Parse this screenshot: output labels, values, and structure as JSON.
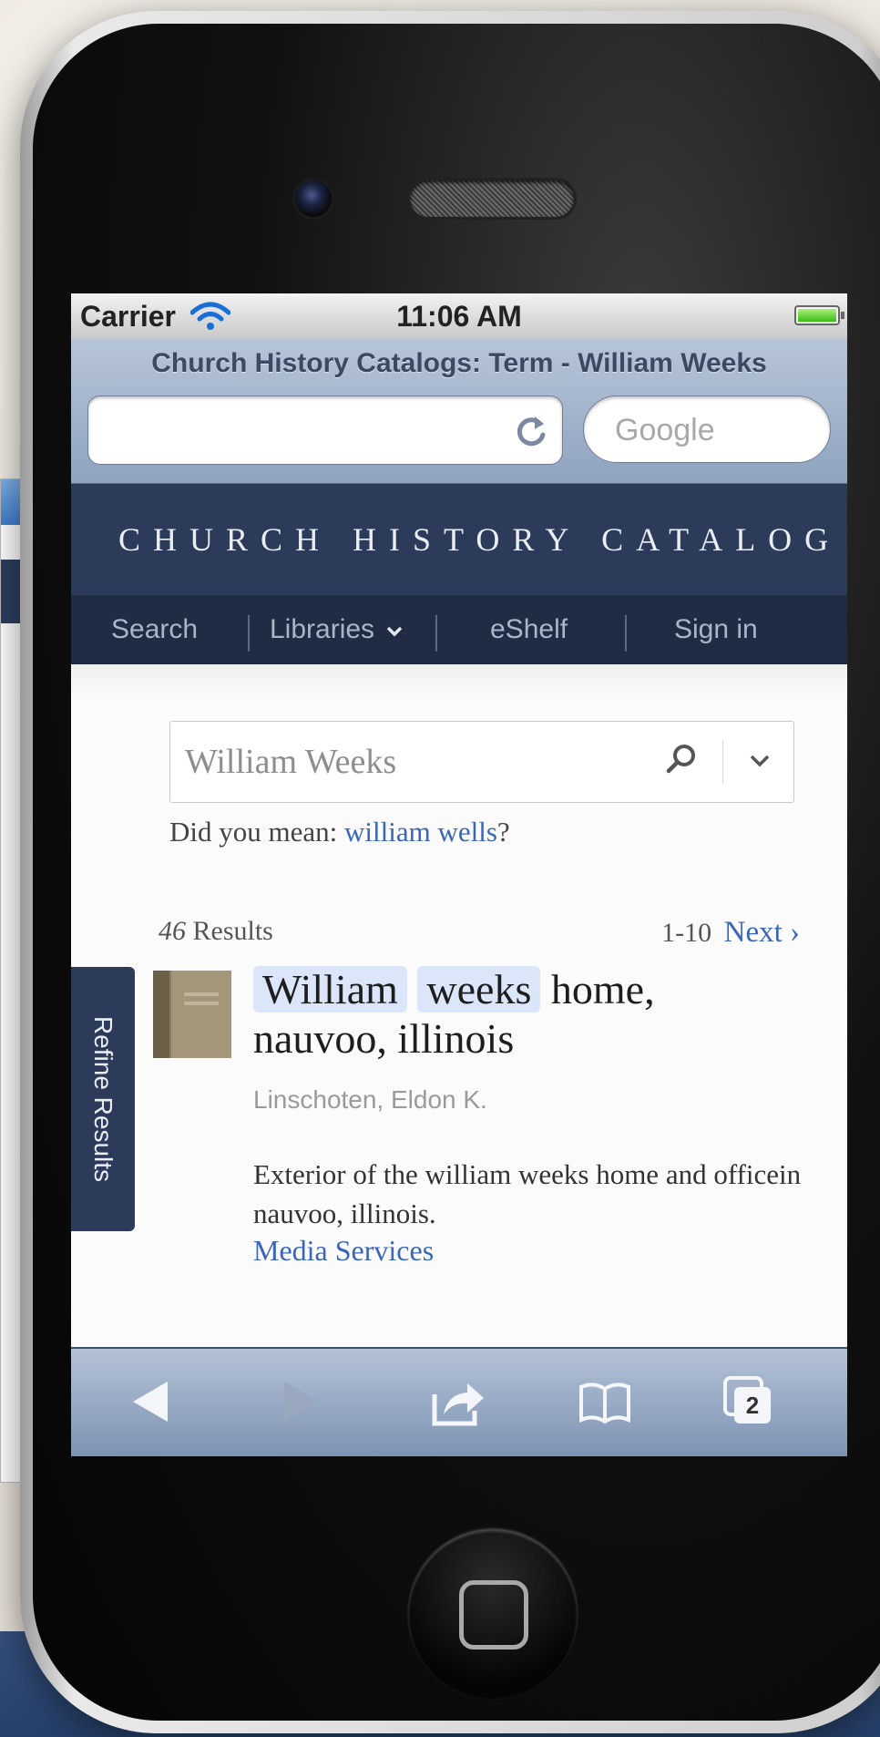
{
  "status_bar": {
    "carrier": "Carrier",
    "time": "11:06 AM"
  },
  "browser": {
    "page_title": "Church History Catalogs: Term - William Weeks",
    "url_value": "",
    "search_placeholder": "Google",
    "tab_count": "2"
  },
  "site": {
    "banner": "CHURCH HISTORY CATALOG",
    "nav": {
      "search": "Search",
      "libraries": "Libraries",
      "eshelf": "eShelf",
      "sign_in": "Sign in"
    }
  },
  "search": {
    "value": "William Weeks",
    "did_you_mean_prefix": "Did you mean: ",
    "suggestion": "william wells",
    "did_you_mean_suffix": "?"
  },
  "results": {
    "count": "46",
    "count_label": " Results",
    "range": "1-10",
    "next_label": "Next ›",
    "refine_label": "Refine Results",
    "items": [
      {
        "title_hl_1": "William",
        "title_hl_2": "weeks",
        "title_rest_1": " home,",
        "title_rest_2": "nauvoo, illinois",
        "author": "Linschoten, Eldon K.",
        "description": "Exterior of the william weeks home and officein nauvoo, illinois.",
        "source": "Media Services"
      }
    ]
  },
  "colors": {
    "banner_bg": "#2c3b5a",
    "nav_bg": "#1f2c44",
    "link": "#3b66b8",
    "highlight": "#dbe6fb"
  }
}
